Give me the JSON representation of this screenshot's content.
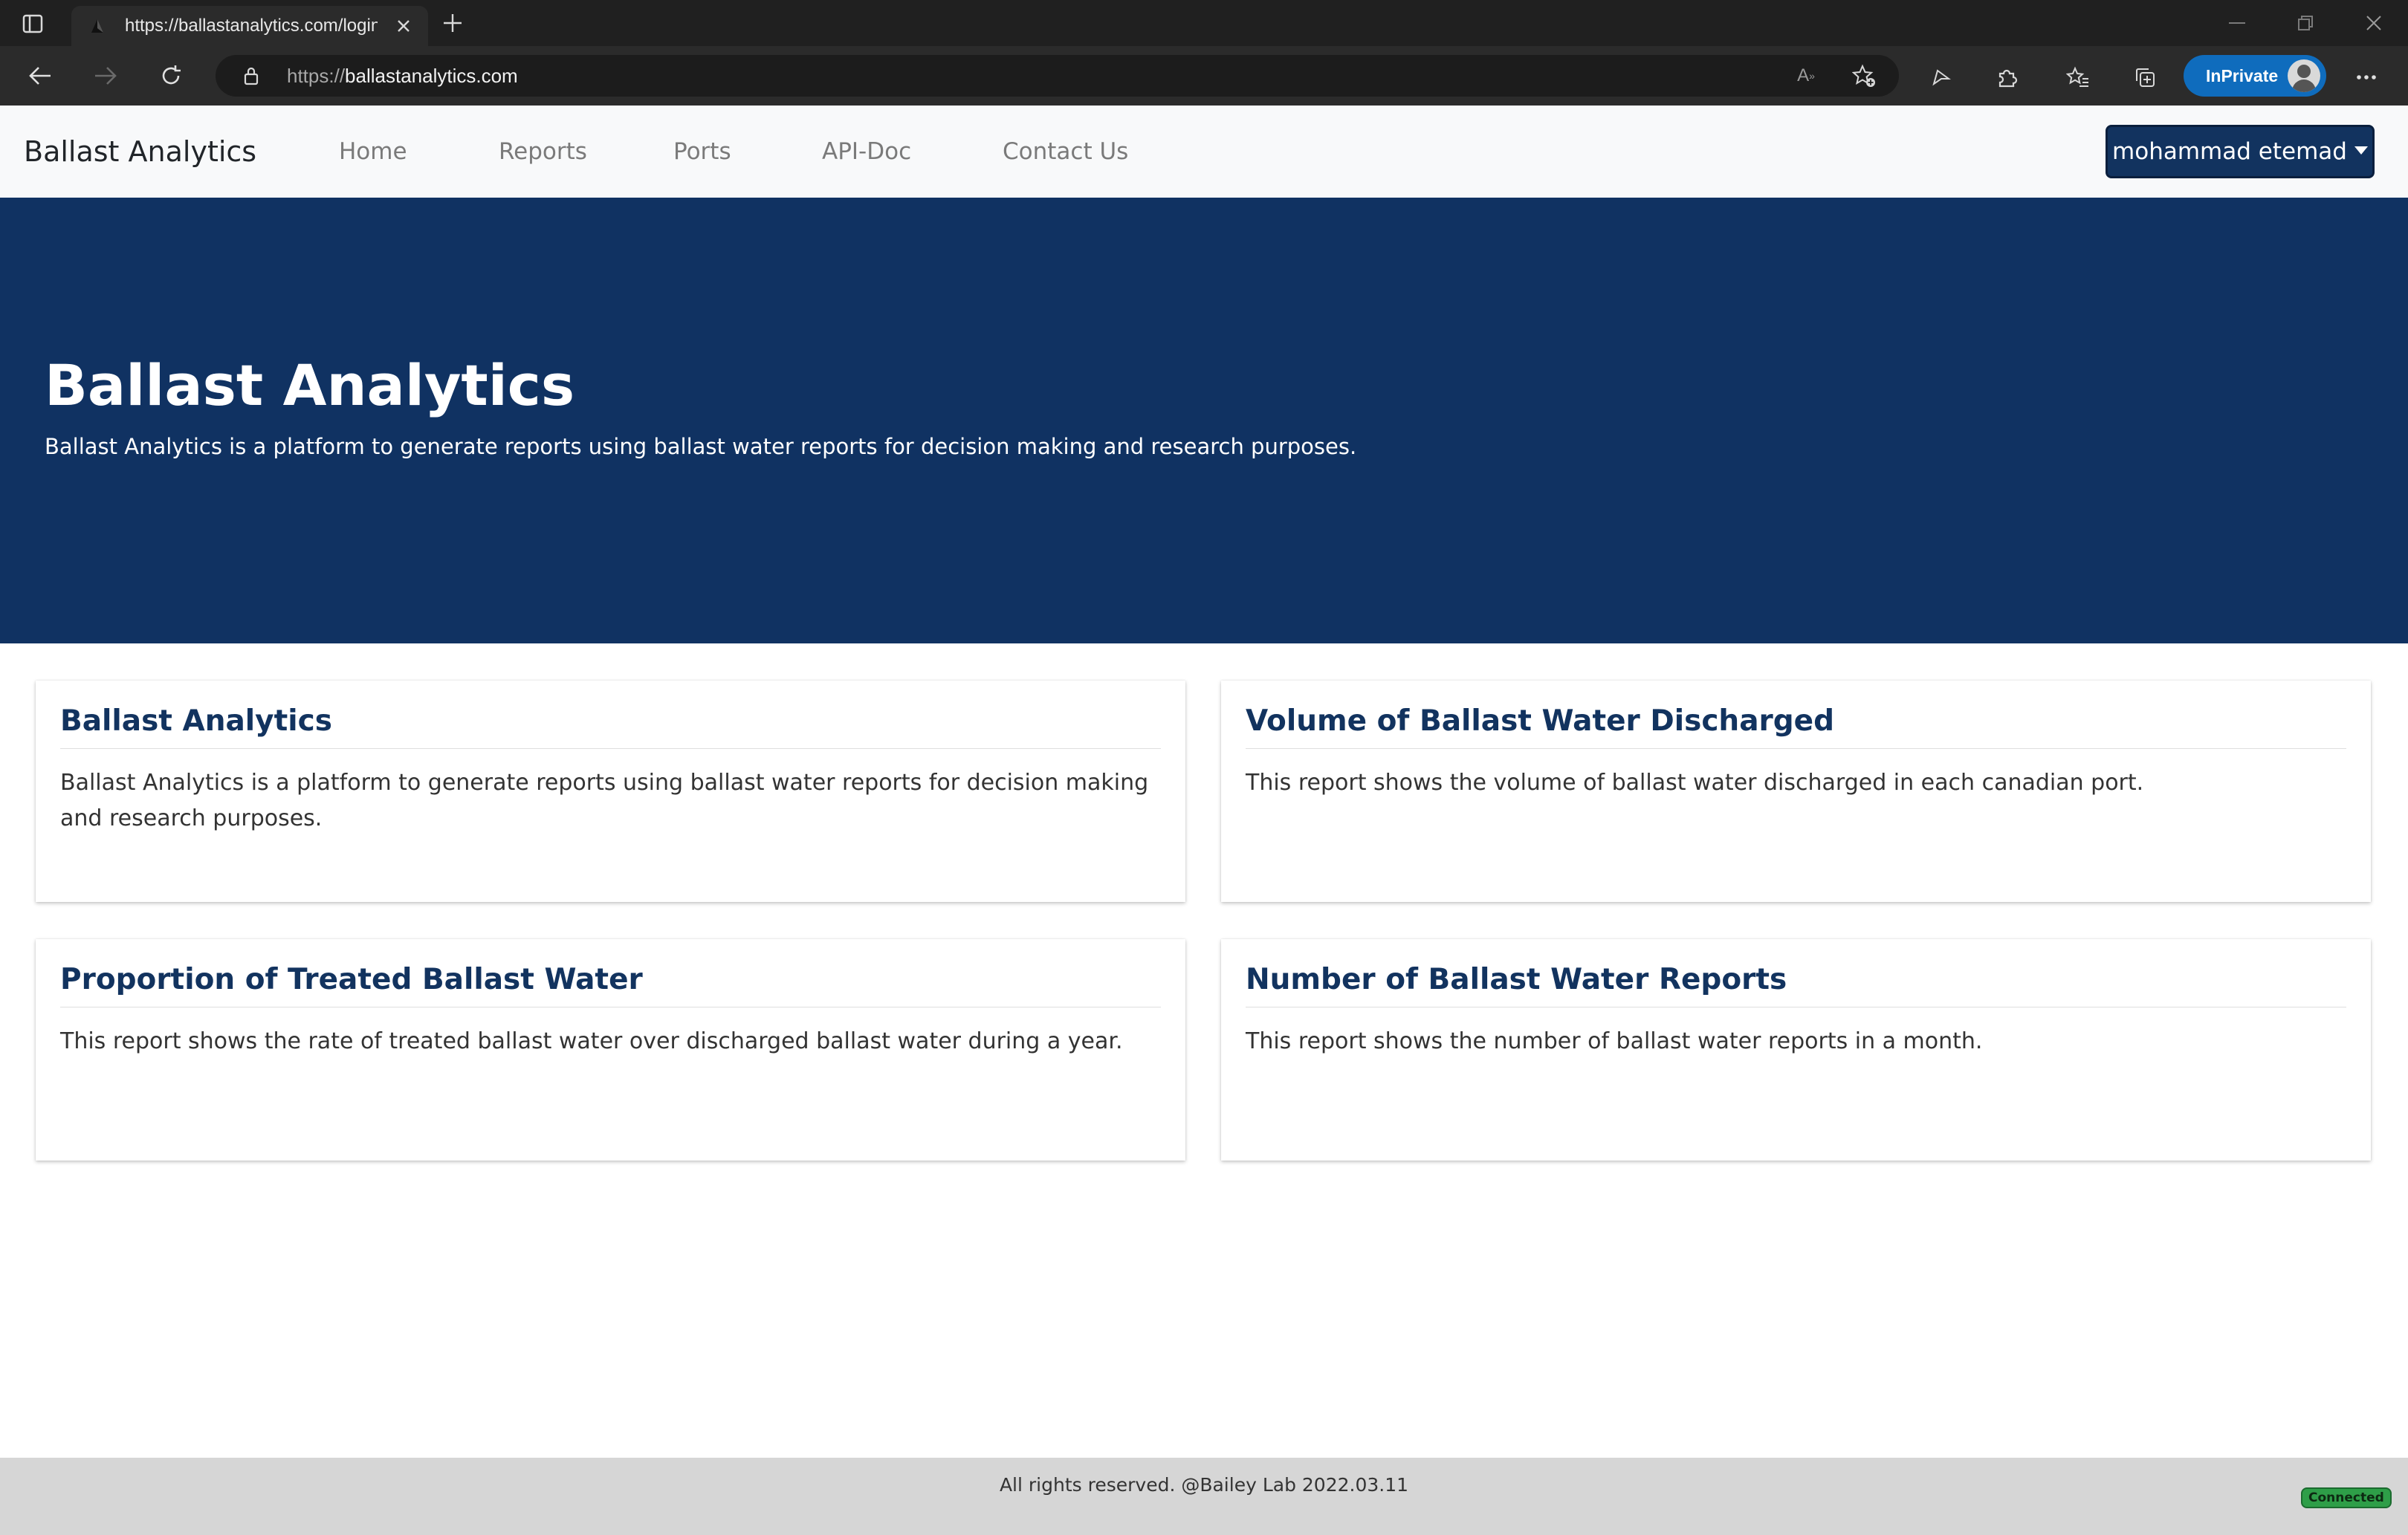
{
  "browser": {
    "tab_title": "https://ballastanalytics.com/login",
    "url_scheme": "https://",
    "url_host": "ballastanalytics.com",
    "inprivate_label": "InPrivate",
    "icons": [
      "sidebar-icon",
      "favicon",
      "tab-close-icon",
      "new-tab-icon",
      "minimize-icon",
      "restore-icon",
      "window-close-icon",
      "back-icon",
      "forward-icon",
      "refresh-icon",
      "lock-icon",
      "read-aloud-icon",
      "add-favorite-icon",
      "share-icon",
      "extensions-icon",
      "favorites-icon",
      "collections-icon",
      "more-icon"
    ]
  },
  "nav": {
    "brand": "Ballast Analytics",
    "links": [
      "Home",
      "Reports",
      "Ports",
      "API-Doc",
      "Contact Us"
    ],
    "user": "mohammad etemad"
  },
  "hero": {
    "title": "Ballast Analytics",
    "subtitle": "Ballast Analytics is a platform to generate reports using ballast water reports for decision making and research purposes."
  },
  "cards": [
    {
      "title": "Ballast Analytics",
      "text": "Ballast Analytics is a platform to generate reports using ballast water reports for decision making and research purposes."
    },
    {
      "title": "Volume of Ballast Water Discharged",
      "text": "This report shows the volume of ballast water discharged in each canadian port."
    },
    {
      "title": "Proportion of Treated Ballast Water",
      "text": "This report shows the rate of treated ballast water over discharged ballast water during a year."
    },
    {
      "title": "Number of Ballast Water Reports",
      "text": "This report shows the number of ballast water reports in a month."
    }
  ],
  "footer": {
    "text": "All rights reserved. @Bailey Lab 2022.03.11",
    "status": "Connected"
  },
  "colors": {
    "hero_bg": "#103262",
    "card_title": "#12335f",
    "user_button": "#12335f",
    "footer_bg": "#d6d6d6",
    "status_badge": "#2e9e48",
    "inprivate_badge": "#0f6cbd"
  }
}
